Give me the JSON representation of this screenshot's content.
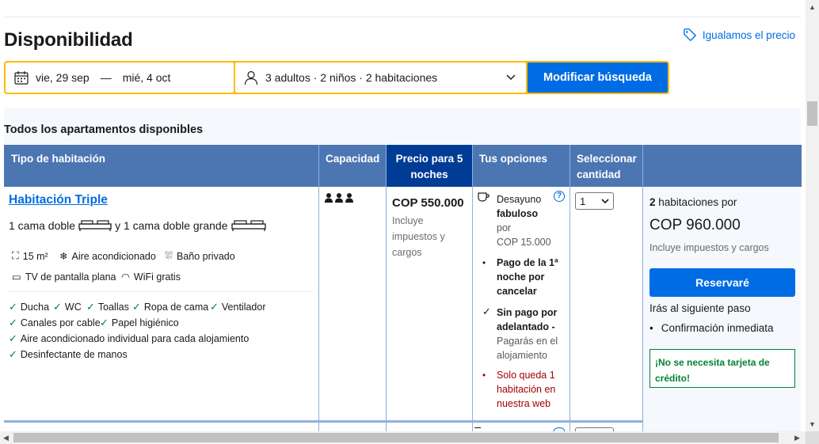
{
  "header": {
    "title": "Disponibilidad",
    "price_match": "Igualamos el precio"
  },
  "search": {
    "checkin": "vie, 29 sep",
    "separator": "—",
    "checkout": "mié, 4 oct",
    "guests": "3 adultos · 2 niños · 2 habitaciones",
    "button": "Modificar búsqueda"
  },
  "section_title": "Todos los apartamentos disponibles",
  "table": {
    "headers": {
      "room_type": "Tipo de habitación",
      "capacity": "Capacidad",
      "price": "Precio para 5 noches",
      "options": "Tus opciones",
      "quantity": "Seleccionar cantidad"
    }
  },
  "room": {
    "name": "Habitación Triple",
    "beds_part1": "1 cama doble",
    "beds_join": "y 1 cama doble grande",
    "facilities": [
      "15 m²",
      "Aire acondicionado",
      "Baño privado",
      "TV de pantalla plana",
      "WiFi gratis"
    ],
    "amenities": [
      "Ducha",
      "WC",
      "Toallas",
      "Ropa de cama",
      "Ventilador",
      "Canales por cable",
      "Papel higiénico",
      "Aire acondicionado individual para cada alojamiento",
      "Desinfectante de manos"
    ],
    "price": "COP 550.000",
    "price_note": "Incluye impuestos y cargos",
    "options": {
      "breakfast_line1": "Desayuno",
      "breakfast_line2": "fabuloso",
      "breakfast_line3": "por",
      "breakfast_line4": "COP 15.000",
      "payment_l1": "Pago de la 1ª",
      "payment_l2": "noche por",
      "payment_l3": "cancelar",
      "no_prepay_l1": "Sin pago por",
      "no_prepay_l2": "adelantado -",
      "no_prepay_l3": "Pagarás en el",
      "no_prepay_l4": "alojamiento",
      "scarcity_l1": "Solo queda 1",
      "scarcity_l2": "habitación en",
      "scarcity_l3": "nuestra web"
    },
    "quantity": "1"
  },
  "summary": {
    "count": "2",
    "count_suffix": "habitaciones por",
    "total": "COP 960.000",
    "note": "Incluye impuestos y cargos",
    "reserve": "Reservaré",
    "next_step": "Irás al siguiente paso",
    "instant": "Confirmación inmediata",
    "no_card": "¡No se necesita tarjeta de crédito!"
  },
  "colors": {
    "accent": "#006ce4",
    "header_blue": "#4c76b2",
    "dark_blue": "#003b95",
    "search_border": "#febb02",
    "green": "#008234",
    "red": "#a30000"
  }
}
